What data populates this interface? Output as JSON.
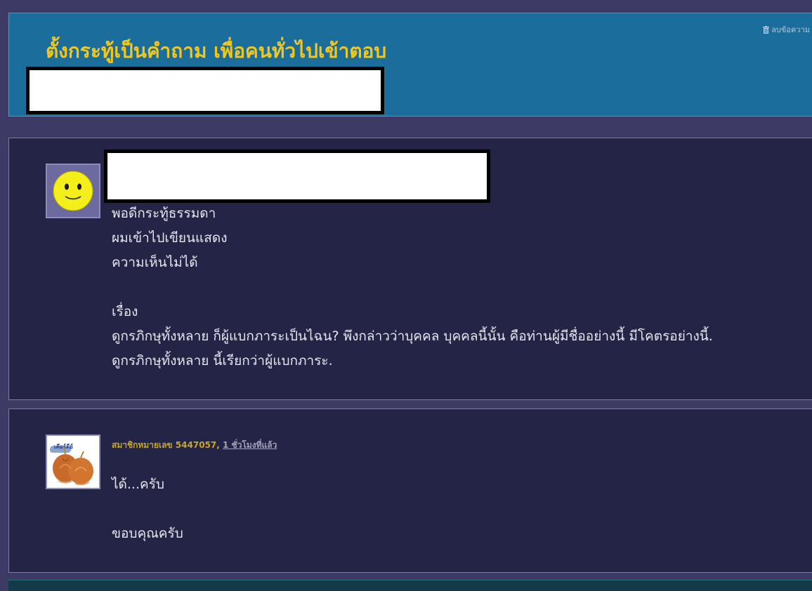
{
  "topic": {
    "title": "ตั้งกระทู้เป็นคำถาม เพื่อคนทั่วไปเข้าตอบ",
    "delete_label": "ลบข้อความ"
  },
  "comments": [
    {
      "avatar_icon": "smiley-face-icon",
      "body": "พอดีกระทู้ธรรมดา\nผมเข้าไปเขียนแสดง\nความเห็นไม่ได้\n\nเรื่อง\nดูกรภิกษุทั้งหลาย ก็ผู้แบกภาระเป็นไฉน? พึงกล่าวว่าบุคคล บุคคลนี้นั้น คือท่านผู้มีชื่ออย่างนี้ มีโคตรอย่างนี้.\nดูกรภิกษุทั้งหลาย นี้เรียกว่าผู้แบกภาระ."
    },
    {
      "avatar_icon": "onion-avatar-icon",
      "avatar_label": "เคียร์ดีย์",
      "member": "สมาชิกหมายเลข 5447057,",
      "time": "1 ชั่วโมงที่แล้ว",
      "body": "ได้...ครับ\n\nขอบคุณครับ"
    }
  ],
  "colors": {
    "background": "#3e3a66",
    "header": "#1b6e9b",
    "title": "#f2c71d",
    "post_bg": "#232446"
  }
}
